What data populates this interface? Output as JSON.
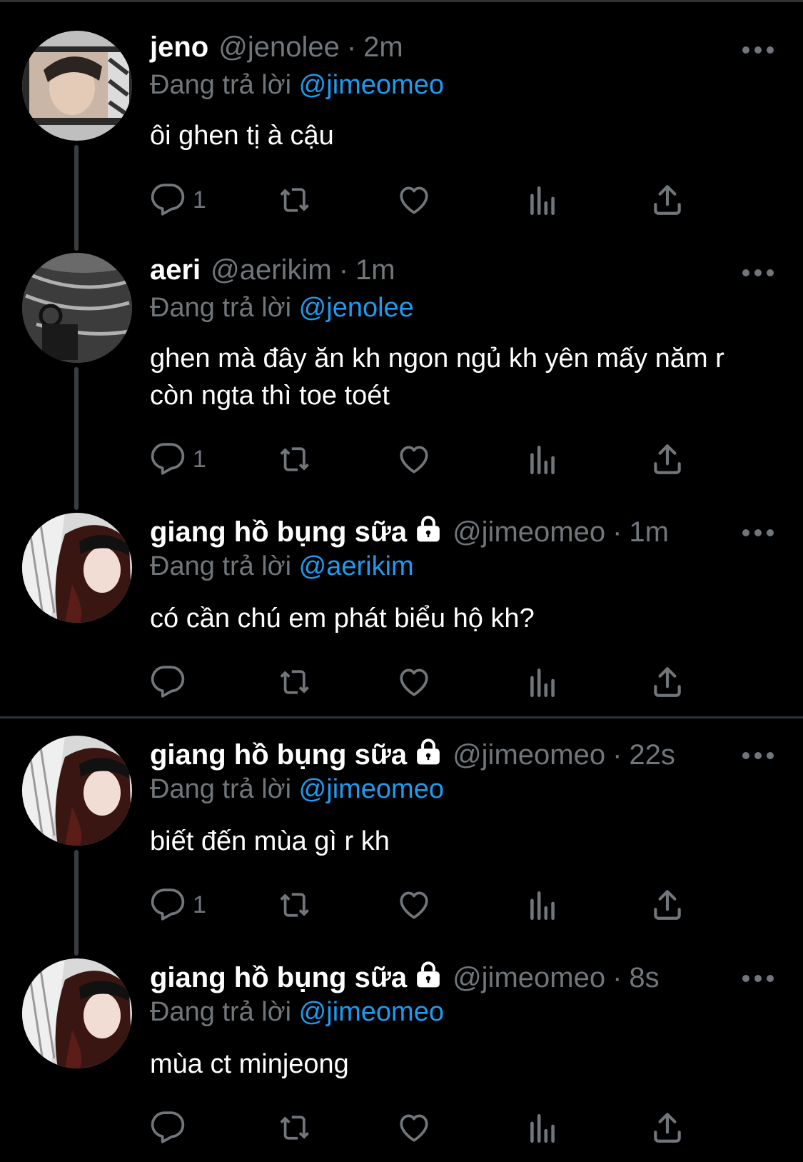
{
  "thread": [
    {
      "name": "jeno",
      "handle": "@jenolee",
      "time": "2m",
      "locked": false,
      "replying_label": "Đang trả lời",
      "replying_to": "@jimeomeo",
      "text": "ôi ghen tị à cậu",
      "reply_count": "1",
      "avatar": "jeno"
    },
    {
      "name": "aeri",
      "handle": "@aerikim",
      "time": "1m",
      "locked": false,
      "replying_label": "Đang trả lời",
      "replying_to": "@jenolee",
      "text": "ghen mà đây ăn kh ngon ngủ kh yên mấy năm r còn ngta thì toe toét",
      "reply_count": "1",
      "avatar": "aeri"
    },
    {
      "name": "giang hồ bụng sữa",
      "handle": "@jimeomeo",
      "time": "1m",
      "locked": true,
      "replying_label": "Đang trả lời",
      "replying_to": "@aerikim",
      "text": "có cần chú em phát biểu hộ kh?",
      "reply_count": "",
      "avatar": "giang"
    },
    {
      "name": "giang hồ bụng sữa",
      "handle": "@jimeomeo",
      "time": "22s",
      "locked": true,
      "replying_label": "Đang trả lời",
      "replying_to": "@jimeomeo",
      "text": "biết đến mùa gì r kh",
      "reply_count": "1",
      "avatar": "giang"
    },
    {
      "name": "giang hồ bụng sữa",
      "handle": "@jimeomeo",
      "time": "8s",
      "locked": true,
      "replying_label": "Đang trả lời",
      "replying_to": "@jimeomeo",
      "text": "mùa ct minjeong",
      "reply_count": "",
      "avatar": "giang"
    }
  ],
  "separator": "·",
  "colors": {
    "background": "#000000",
    "muted": "#71767b",
    "mention": "#1d9bf0",
    "text": "#ffffff"
  },
  "icons": [
    "more-icon",
    "reply-icon",
    "retweet-icon",
    "like-icon",
    "views-icon",
    "share-icon",
    "lock-icon"
  ]
}
